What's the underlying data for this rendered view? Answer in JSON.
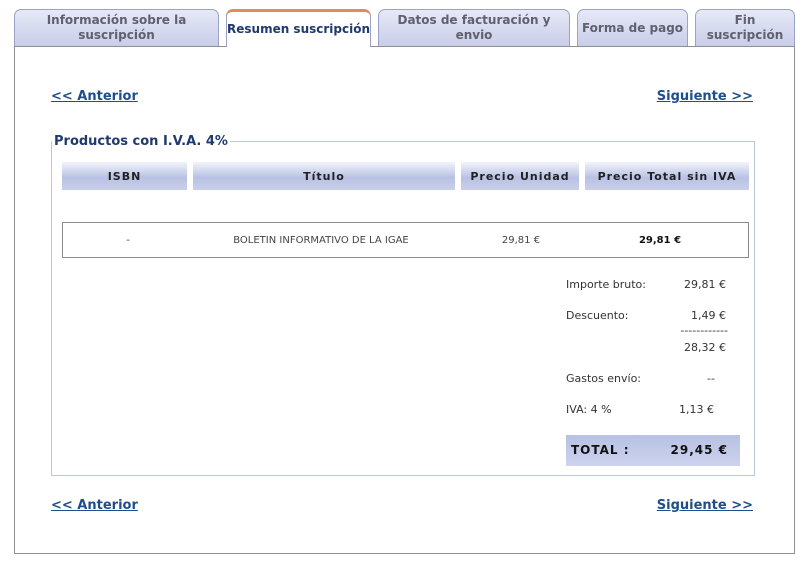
{
  "tabs": [
    {
      "label": "Información sobre la suscripción"
    },
    {
      "label": "Resumen suscripción"
    },
    {
      "label": "Datos de facturación y envio"
    },
    {
      "label": "Forma de pago"
    },
    {
      "label": "Fin suscripción"
    }
  ],
  "nav": {
    "prev": "<< Anterior",
    "next": "Siguiente >>"
  },
  "section": {
    "legend": "Productos con I.V.A. 4%"
  },
  "table": {
    "headers": [
      "ISBN",
      "Título",
      "Precio Unidad",
      "Precio Total sin IVA"
    ],
    "rows": [
      {
        "isbn": "-",
        "title": "BOLETIN INFORMATIVO DE LA IGAE",
        "unit_price": "29,81 €",
        "total": "29,81 €"
      }
    ]
  },
  "summary": {
    "gross_label": "Importe bruto:",
    "gross_value": "29,81 €",
    "discount_label": "Descuento:",
    "discount_value": "1,49 €",
    "separator": "------------",
    "subtotal_value": "28,32 €",
    "shipping_label": "Gastos envío:",
    "shipping_value": "--",
    "vat_label": "IVA: 4 %",
    "vat_value": "1,13 €",
    "total_label": "TOTAL :",
    "total_value": "29,45 €"
  },
  "colors": {
    "accent_tab_border": "#e28c5a",
    "link": "#1f4e8c",
    "header_gradient": "#b9c2e4"
  }
}
